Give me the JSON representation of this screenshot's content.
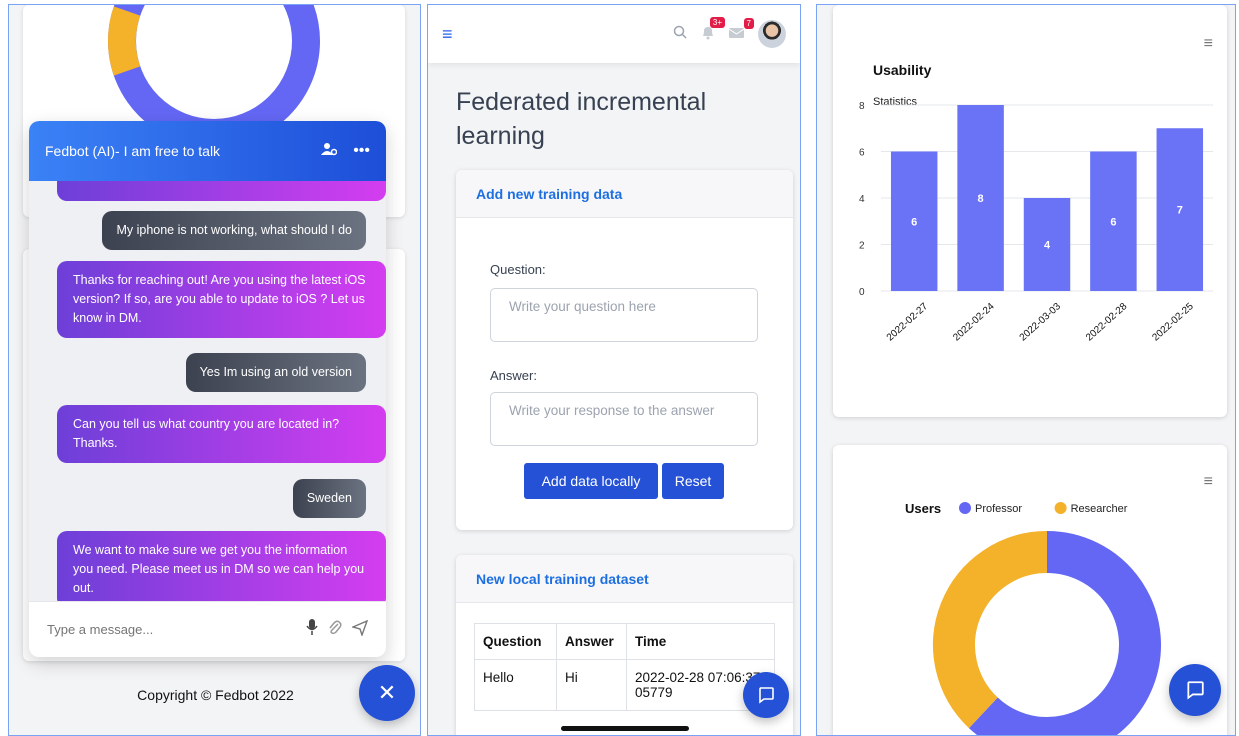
{
  "chatbot": {
    "header_title": "Fedbot (AI)- I am free to talk",
    "messages": [
      {
        "from": "user",
        "text": "My iphone is not working, what should I do"
      },
      {
        "from": "bot",
        "text": "Thanks for reaching out! Are you using the latest iOS version? If so, are you able to update to iOS ? Let us know in DM."
      },
      {
        "from": "user",
        "text": "Yes Im using an old version"
      },
      {
        "from": "bot",
        "text": "Can you tell us what country you are located in? Thanks."
      },
      {
        "from": "user",
        "text": "Sweden"
      },
      {
        "from": "bot",
        "text": "We want to make sure we get you the information you need. Please meet us in DM so we can help you out."
      }
    ],
    "input_placeholder": "Type a message...",
    "close_glyph": "✕"
  },
  "footer": {
    "copyright": "Copyright © Fedbot 2022"
  },
  "topbar": {
    "notif_badge": "3+",
    "msg_badge": "7"
  },
  "page": {
    "title": "Federated incremental learning"
  },
  "add_form": {
    "header": "Add new training data",
    "question_label": "Question:",
    "question_placeholder": "Write your question here",
    "answer_label": "Answer:",
    "answer_placeholder": "Write your response to the answer",
    "add_button": "Add data locally",
    "reset_button": "Reset"
  },
  "dataset": {
    "header": "New local training dataset",
    "columns": [
      "Question",
      "Answer",
      "Time"
    ],
    "rows": [
      [
        "Hello",
        "Hi",
        "2022-02-28 07:06:37.05779"
      ]
    ]
  },
  "colors": {
    "accent": "#2451d6",
    "bar": "#6a72f5",
    "professor": "#6367f4",
    "researcher": "#f4b12a"
  },
  "chart_data": [
    {
      "type": "bar",
      "title": "Usability",
      "subtitle": "Statistics",
      "categories": [
        "2022-02-27",
        "2022-02-24",
        "2022-03-03",
        "2022-02-28",
        "2022-02-25"
      ],
      "values": [
        6,
        8,
        4,
        6,
        7
      ],
      "ylim": [
        0,
        8
      ],
      "yticks": [
        "0",
        "2",
        "4",
        "6",
        "8"
      ],
      "grid": true
    },
    {
      "type": "pie",
      "donut": true,
      "title": "Users",
      "series": [
        {
          "name": "Professor",
          "value": 62,
          "color": "#6367f4"
        },
        {
          "name": "Researcher",
          "value": 38,
          "color": "#f4b12a"
        }
      ],
      "legend": "top"
    }
  ]
}
